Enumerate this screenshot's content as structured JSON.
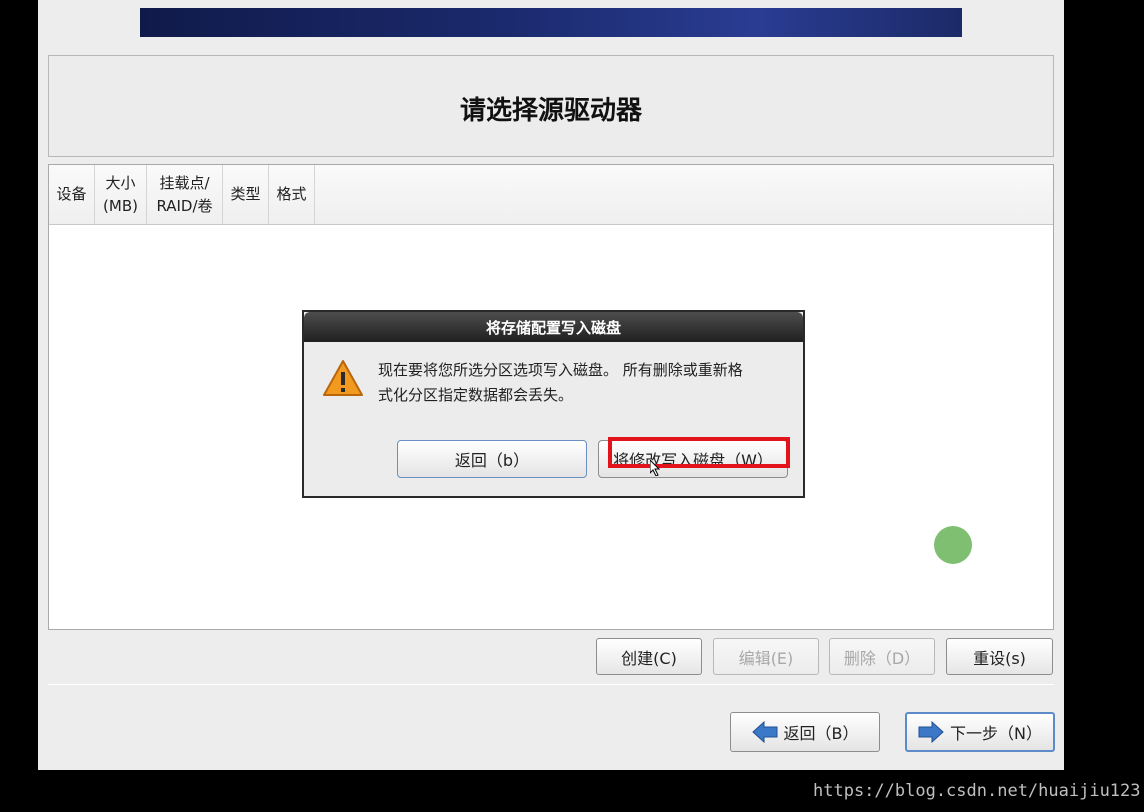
{
  "header": {
    "title": "请选择源驱动器"
  },
  "table": {
    "columns": [
      {
        "line1": "设备",
        "line2": ""
      },
      {
        "line1": "大小",
        "line2": "(MB)"
      },
      {
        "line1": "挂载点/",
        "line2": "RAID/卷"
      },
      {
        "line1": "类型",
        "line2": ""
      },
      {
        "line1": "格式",
        "line2": ""
      }
    ]
  },
  "toolbar": {
    "create_label": "创建(C)",
    "edit_label": "编辑(E)",
    "delete_label": "删除（D）",
    "reset_label": "重设(s)"
  },
  "nav": {
    "back_label": "返回（B）",
    "next_label": "下一步（N）"
  },
  "dialog": {
    "title": "将存储配置写入磁盘",
    "message_line1": "现在要将您所选分区选项写入磁盘。 所有删除或重新格",
    "message_line2": "式化分区指定数据都会丢失。",
    "back_label": "返回（b）",
    "write_label": "将修改写入磁盘（W）"
  },
  "icons": {
    "warning": "warning-icon",
    "back_arrow": "arrow-left-icon",
    "next_arrow": "arrow-right-icon"
  },
  "colors": {
    "highlight": "#e3131b",
    "banner": "#1b2a6e",
    "arrow": "#3b78c8"
  },
  "watermark": "https://blog.csdn.net/huaijiu123"
}
